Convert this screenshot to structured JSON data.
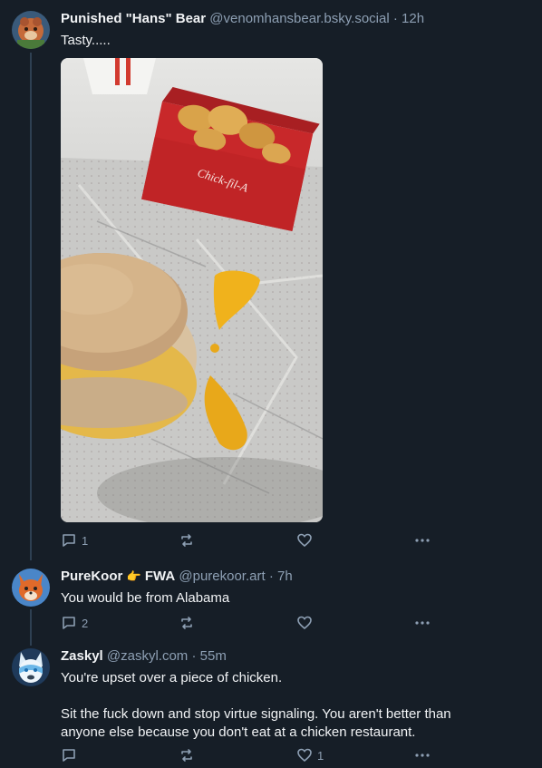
{
  "posts": [
    {
      "name": "Punished \"Hans\" Bear",
      "handle": "@venomhansbear.bsky.social",
      "time": "12h",
      "text": "Tasty.....",
      "replies": "1",
      "reposts": "",
      "likes": "",
      "avatar_color": "#c56a3a"
    },
    {
      "name": "PureKoor",
      "badge_icon": "pointing-hand-emoji",
      "badge_text": "FWA",
      "handle": "@purekoor.art",
      "time": "7h",
      "text": "You would be from Alabama",
      "replies": "2",
      "reposts": "",
      "likes": "",
      "avatar_color": "#4a86c8"
    },
    {
      "name": "Zaskyl",
      "handle": "@zaskyl.com",
      "time": "55m",
      "text": "You're upset over a piece of chicken.\n\nSit the fuck down and stop virtue signaling. You aren't better than\nanyone else because you don't eat at a chicken restaurant.",
      "replies": "",
      "reposts": "",
      "likes": "1",
      "avatar_color": "#6ab7e8"
    }
  ],
  "image": {
    "box_brand": "Chick-fil-A",
    "description_icon": "food-photo"
  },
  "colors": {
    "background": "#161e27",
    "muted": "#8d9fb3",
    "thread_line": "#2e4052"
  },
  "separator": "·"
}
